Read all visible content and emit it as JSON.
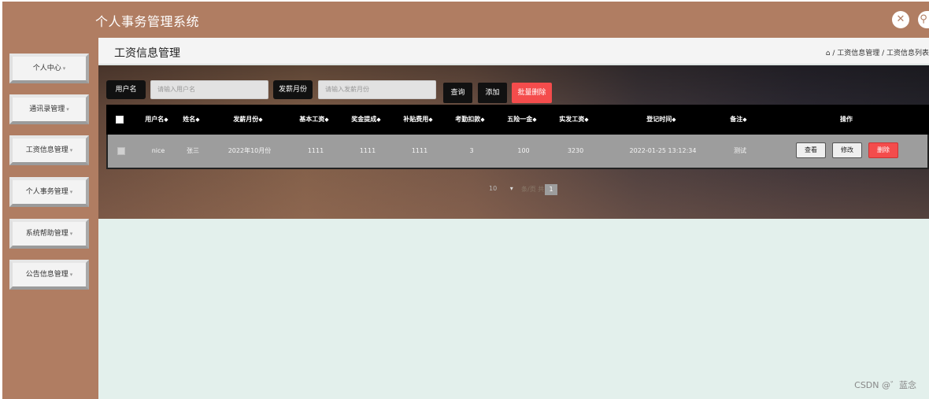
{
  "app": {
    "title": "个人事务管理系统"
  },
  "top_icons": [
    "fullscreen-icon",
    "user-icon"
  ],
  "sidebar": {
    "items": [
      {
        "label": "个人中心"
      },
      {
        "label": "通讯录管理"
      },
      {
        "label": "工资信息管理"
      },
      {
        "label": "个人事务管理"
      },
      {
        "label": "系统帮助管理"
      },
      {
        "label": "公告信息管理"
      }
    ],
    "caret": "▾"
  },
  "header": {
    "page_title": "工资信息管理",
    "breadcrumb": "⌂ / 工资信息管理 / 工资信息列表"
  },
  "filters": {
    "username_label": "用户名",
    "username_placeholder": "请输入用户名",
    "month_label": "发薪月份",
    "month_placeholder": "请输入发薪月份",
    "search_label": "查询",
    "add_label": "添加",
    "batch_delete_label": "批量删除"
  },
  "table": {
    "sort_glyph": "◆",
    "columns": [
      "用户名",
      "姓名",
      "发薪月份",
      "基本工资",
      "奖金提成",
      "补贴费用",
      "考勤扣款",
      "五险一金",
      "实发工资",
      "登记时间",
      "备注",
      "操作"
    ],
    "rows": [
      {
        "username": "nice",
        "name": "张三",
        "month": "2022年10月份",
        "base_salary": "1111",
        "bonus": "1111",
        "subsidy": "1111",
        "deduction": "3",
        "insurance": "100",
        "net_salary": "3230",
        "registered": "2022-01-25 13:12:34",
        "note": "测试"
      }
    ],
    "actions": {
      "view": "查看",
      "edit": "修改",
      "delete": "删除"
    }
  },
  "pagination": {
    "page_size": "10",
    "total_text": "条/页 共",
    "current_page": "1"
  },
  "watermark": "CSDN @゛蓝念",
  "colors": {
    "brand": "#b07d62",
    "danger": "#f44c4c",
    "content_bg": "#e3f0ec"
  }
}
